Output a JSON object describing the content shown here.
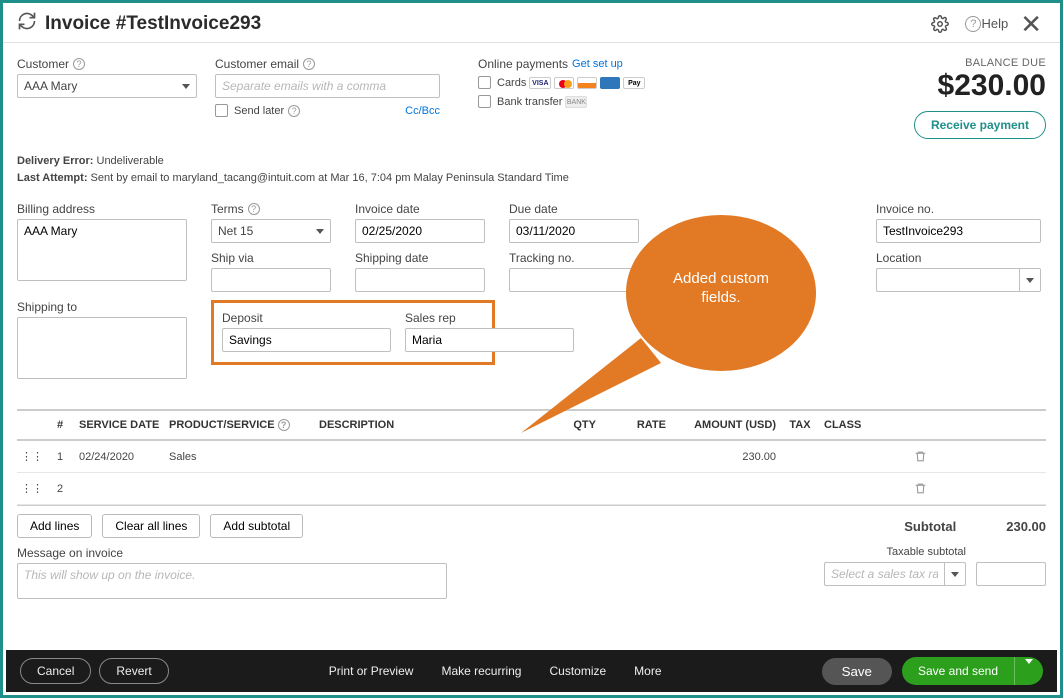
{
  "header": {
    "title": "Invoice #TestInvoice293",
    "help_label": "Help"
  },
  "customer": {
    "label": "Customer",
    "value": "AAA Mary",
    "email_label": "Customer email",
    "email_placeholder": "Separate emails with a comma",
    "send_later_label": "Send later",
    "ccbcc_label": "Cc/Bcc"
  },
  "online_payments": {
    "label": "Online payments",
    "setup_link": "Get set up",
    "cards_label": "Cards",
    "bank_label": "Bank transfer"
  },
  "balance": {
    "label": "BALANCE DUE",
    "amount": "$230.00",
    "receive_label": "Receive payment"
  },
  "delivery": {
    "error_label": "Delivery Error:",
    "error_value": "Undeliverable",
    "attempt_label": "Last Attempt:",
    "attempt_value": "Sent by email to maryland_tacang@intuit.com at Mar 16, 7:04 pm Malay Peninsula Standard Time"
  },
  "fields": {
    "billing_address_label": "Billing address",
    "billing_address_value": "AAA Mary",
    "terms_label": "Terms",
    "terms_value": "Net 15",
    "invoice_date_label": "Invoice date",
    "invoice_date_value": "02/25/2020",
    "due_date_label": "Due date",
    "due_date_value": "03/11/2020",
    "invoice_no_label": "Invoice no.",
    "invoice_no_value": "TestInvoice293",
    "ship_via_label": "Ship via",
    "shipping_date_label": "Shipping date",
    "tracking_no_label": "Tracking no.",
    "location_label": "Location",
    "shipping_to_label": "Shipping to",
    "deposit_label": "Deposit",
    "deposit_value": "Savings",
    "salesrep_label": "Sales rep",
    "salesrep_value": "Maria"
  },
  "callout": {
    "text": "Added custom fields."
  },
  "table": {
    "headers": {
      "num": "#",
      "service_date": "SERVICE DATE",
      "product": "PRODUCT/SERVICE",
      "description": "DESCRIPTION",
      "qty": "QTY",
      "rate": "RATE",
      "amount": "AMOUNT (USD)",
      "tax": "TAX",
      "class": "CLASS"
    },
    "rows": [
      {
        "num": "1",
        "service_date": "02/24/2020",
        "product": "Sales",
        "description": "",
        "qty": "",
        "rate": "",
        "amount": "230.00",
        "tax": "",
        "class": ""
      },
      {
        "num": "2",
        "service_date": "",
        "product": "",
        "description": "",
        "qty": "",
        "rate": "",
        "amount": "",
        "tax": "",
        "class": ""
      }
    ]
  },
  "below": {
    "add_lines": "Add lines",
    "clear_lines": "Clear all lines",
    "add_subtotal": "Add subtotal",
    "subtotal_label": "Subtotal",
    "subtotal_value": "230.00",
    "msg_label": "Message on invoice",
    "msg_placeholder": "This will show up on the invoice.",
    "taxable_label": "Taxable subtotal",
    "taxrate_placeholder": "Select a sales tax rate"
  },
  "footer": {
    "cancel": "Cancel",
    "revert": "Revert",
    "print": "Print or Preview",
    "recurring": "Make recurring",
    "customize": "Customize",
    "more": "More",
    "save": "Save",
    "save_send": "Save and send"
  }
}
